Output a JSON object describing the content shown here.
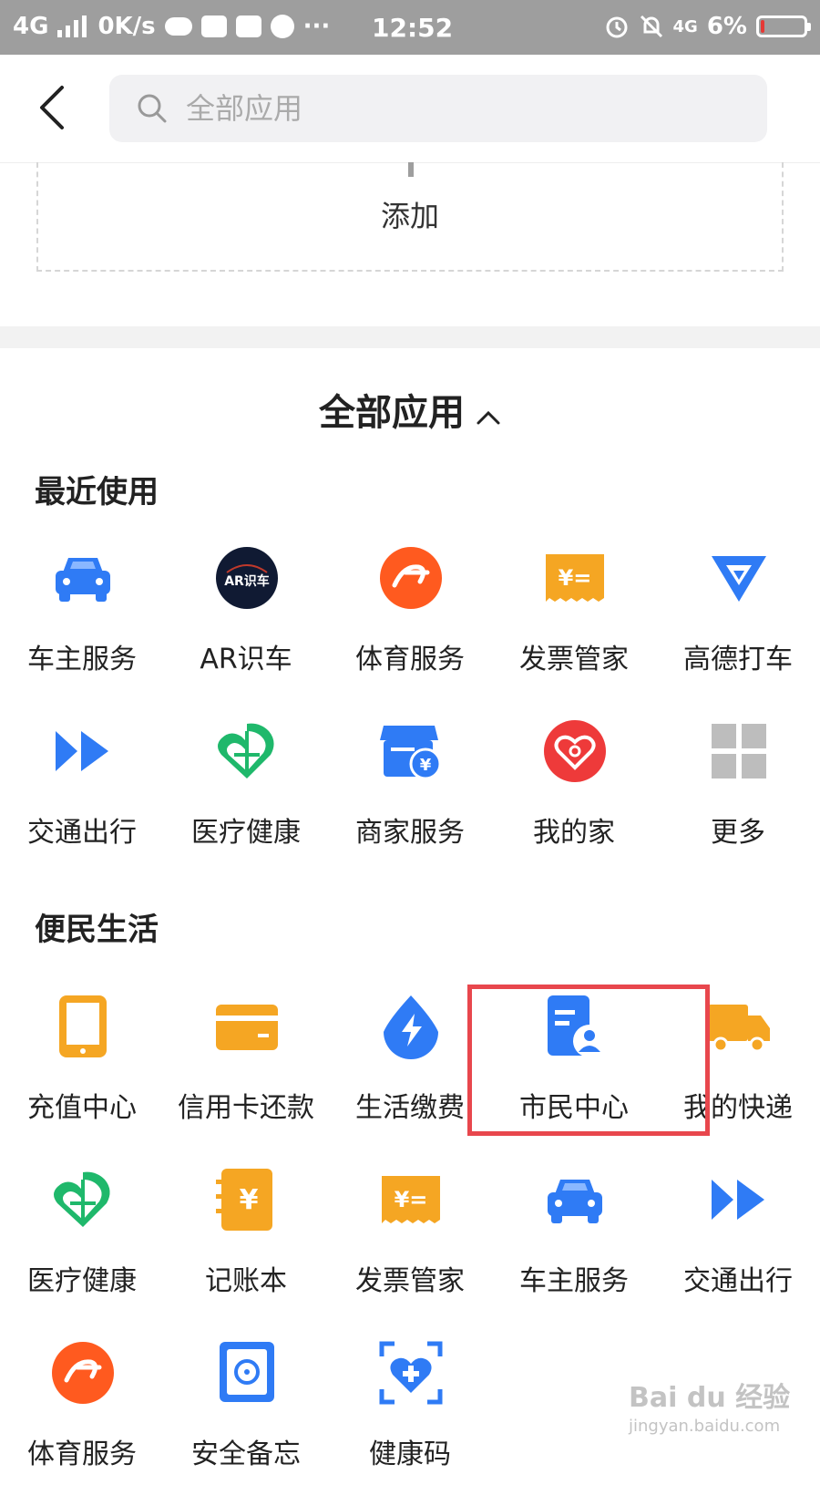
{
  "status_bar": {
    "network": "4G",
    "speed": "0K/s",
    "dots": "···",
    "time": "12:52",
    "net_right": "4G",
    "battery": "6%"
  },
  "header": {
    "search_placeholder": "全部应用"
  },
  "add_section": {
    "label": "添加"
  },
  "all_apps": {
    "title": "全部应用"
  },
  "recent": {
    "title": "最近使用",
    "items": [
      {
        "label": "车主服务",
        "icon": "car-icon"
      },
      {
        "label": "AR识车",
        "icon": "ar-car-icon",
        "badge": "AR识车"
      },
      {
        "label": "体育服务",
        "icon": "sports-icon"
      },
      {
        "label": "发票管家",
        "icon": "invoice-icon",
        "badge": "¥="
      },
      {
        "label": "高德打车",
        "icon": "amap-taxi-icon"
      },
      {
        "label": "交通出行",
        "icon": "transport-icon"
      },
      {
        "label": "医疗健康",
        "icon": "medical-icon"
      },
      {
        "label": "商家服务",
        "icon": "merchant-icon",
        "badge": "¥"
      },
      {
        "label": "我的家",
        "icon": "home-heart-icon"
      },
      {
        "label": "更多",
        "icon": "more-grid-icon"
      }
    ]
  },
  "convenience": {
    "title": "便民生活",
    "items": [
      {
        "label": "充值中心",
        "icon": "phone-recharge-icon"
      },
      {
        "label": "信用卡还款",
        "icon": "credit-card-icon"
      },
      {
        "label": "生活缴费",
        "icon": "utility-bill-icon"
      },
      {
        "label": "市民中心",
        "icon": "citizen-center-icon"
      },
      {
        "label": "我的快递",
        "icon": "delivery-truck-icon"
      },
      {
        "label": "医疗健康",
        "icon": "medical-icon"
      },
      {
        "label": "记账本",
        "icon": "ledger-icon",
        "badge": "¥"
      },
      {
        "label": "发票管家",
        "icon": "invoice-icon",
        "badge": "¥="
      },
      {
        "label": "车主服务",
        "icon": "car-icon"
      },
      {
        "label": "交通出行",
        "icon": "transport-icon"
      },
      {
        "label": "体育服务",
        "icon": "sports-icon"
      },
      {
        "label": "安全备忘",
        "icon": "safe-icon"
      },
      {
        "label": "健康码",
        "icon": "health-code-icon"
      }
    ]
  },
  "watermark": {
    "brand": "Bai du 经验",
    "url": "jingyan.baidu.com"
  },
  "colors": {
    "blue": "#2f7bf5",
    "orange": "#f5a623",
    "sports_orange": "#ff5a1f",
    "green": "#1fb86b",
    "red": "#ee3a3a",
    "gray": "#bdbdbd",
    "highlight": "#e8474d"
  }
}
